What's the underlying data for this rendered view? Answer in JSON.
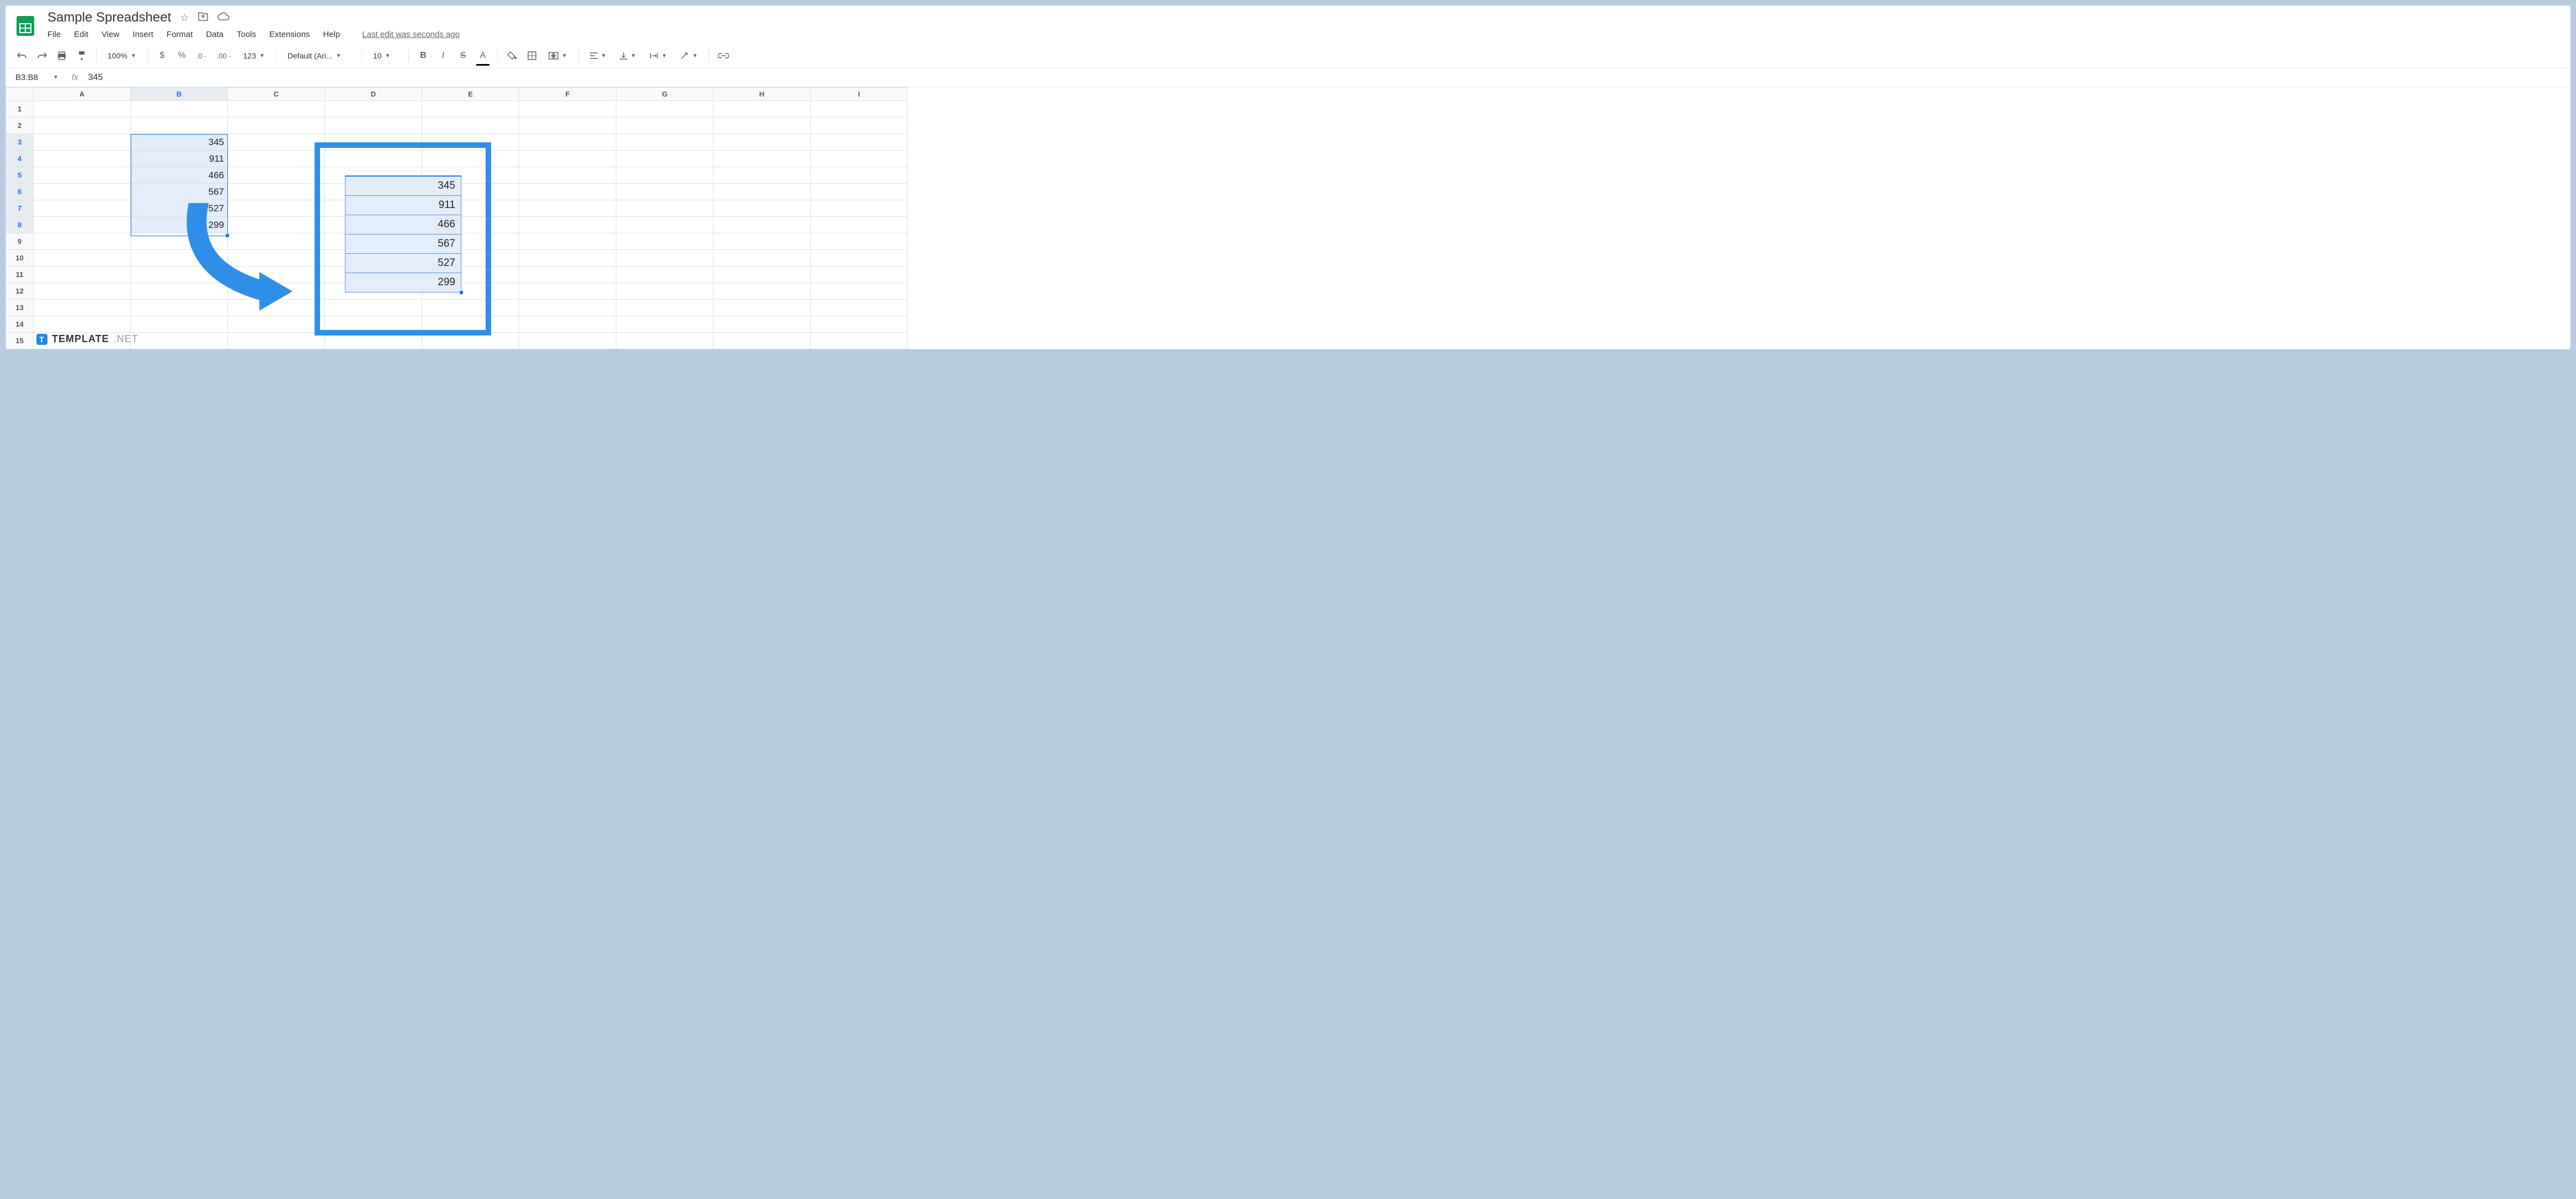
{
  "doc": {
    "title": "Sample Spreadsheet"
  },
  "menu": {
    "file": "File",
    "edit": "Edit",
    "view": "View",
    "insert": "Insert",
    "format": "Format",
    "data": "Data",
    "tools": "Tools",
    "extensions": "Extensions",
    "help": "Help",
    "edit_status": "Last edit was seconds ago"
  },
  "toolbar": {
    "zoom": "100%",
    "currency": "$",
    "percent": "%",
    "dec_dec": ".0",
    "inc_dec": ".00",
    "format_123": "123",
    "font": "Default (Ari...",
    "font_size": "10",
    "bold": "B",
    "italic": "I",
    "strike": "S",
    "text_color": "A"
  },
  "formula": {
    "cell_ref": "B3:B8",
    "fx_label": "fx",
    "value": "345"
  },
  "columns": [
    "A",
    "B",
    "C",
    "D",
    "E",
    "F",
    "G",
    "H",
    "I"
  ],
  "rows": [
    "1",
    "2",
    "3",
    "4",
    "5",
    "6",
    "7",
    "8",
    "9",
    "10",
    "11",
    "12",
    "13",
    "14",
    "15"
  ],
  "cells": {
    "B3": "345",
    "B4": "911",
    "B5": "466",
    "B6": "567",
    "B7": "527",
    "B8": "299"
  },
  "callout": {
    "v1": "345",
    "v2": "911",
    "v3": "466",
    "v4": "567",
    "v5": "527",
    "v6": "299"
  },
  "watermark": {
    "t": "T",
    "text": "TEMPLATE",
    "net": ".NET"
  }
}
